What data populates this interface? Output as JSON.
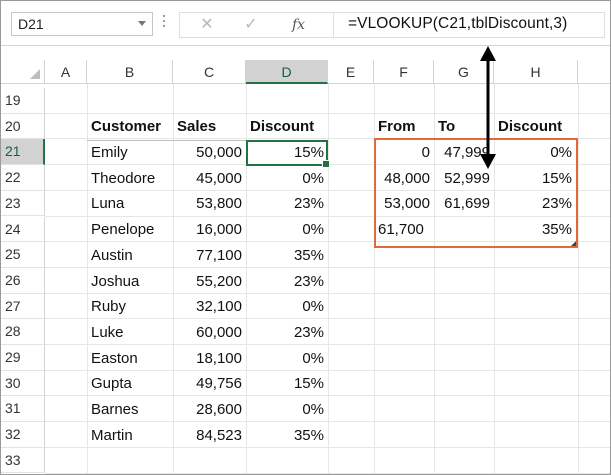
{
  "formula_bar": {
    "name_box": "D21",
    "cancel_symbol": "✕",
    "enter_symbol": "✓",
    "fx_label": "fx",
    "formula": "=VLOOKUP(C21,tblDiscount,3)"
  },
  "columns": [
    "A",
    "B",
    "C",
    "D",
    "E",
    "F",
    "G",
    "H"
  ],
  "selected_column": "D",
  "rows": [
    "19",
    "20",
    "21",
    "22",
    "23",
    "24",
    "25",
    "26",
    "27",
    "28",
    "29",
    "30",
    "31",
    "32",
    "33"
  ],
  "selected_row": "21",
  "customer_table": {
    "headers": [
      "Customer",
      "Sales",
      "Discount"
    ],
    "rows": [
      [
        "Emily",
        "50,000",
        "15%"
      ],
      [
        "Theodore",
        "45,000",
        "0%"
      ],
      [
        "Luna",
        "53,800",
        "23%"
      ],
      [
        "Penelope",
        "16,000",
        "0%"
      ],
      [
        "Austin",
        "77,100",
        "35%"
      ],
      [
        "Joshua",
        "55,200",
        "23%"
      ],
      [
        "Ruby",
        "32,100",
        "0%"
      ],
      [
        "Luke",
        "60,000",
        "23%"
      ],
      [
        "Easton",
        "18,100",
        "0%"
      ],
      [
        "Gupta",
        "49,756",
        "15%"
      ],
      [
        "Barnes",
        "28,600",
        "0%"
      ],
      [
        "Martin",
        "84,523",
        "35%"
      ]
    ]
  },
  "discount_table": {
    "headers": [
      "From",
      "To",
      "Discount"
    ],
    "rows": [
      [
        "0",
        "47,999",
        "0%"
      ],
      [
        "48,000",
        "52,999",
        "15%"
      ],
      [
        "53,000",
        "61,699",
        "23%"
      ],
      [
        "61,700",
        "",
        "35%"
      ]
    ],
    "border_color": "#e2683a"
  },
  "colors": {
    "selection_green": "#217346",
    "annotation_arrow": "#000000"
  }
}
